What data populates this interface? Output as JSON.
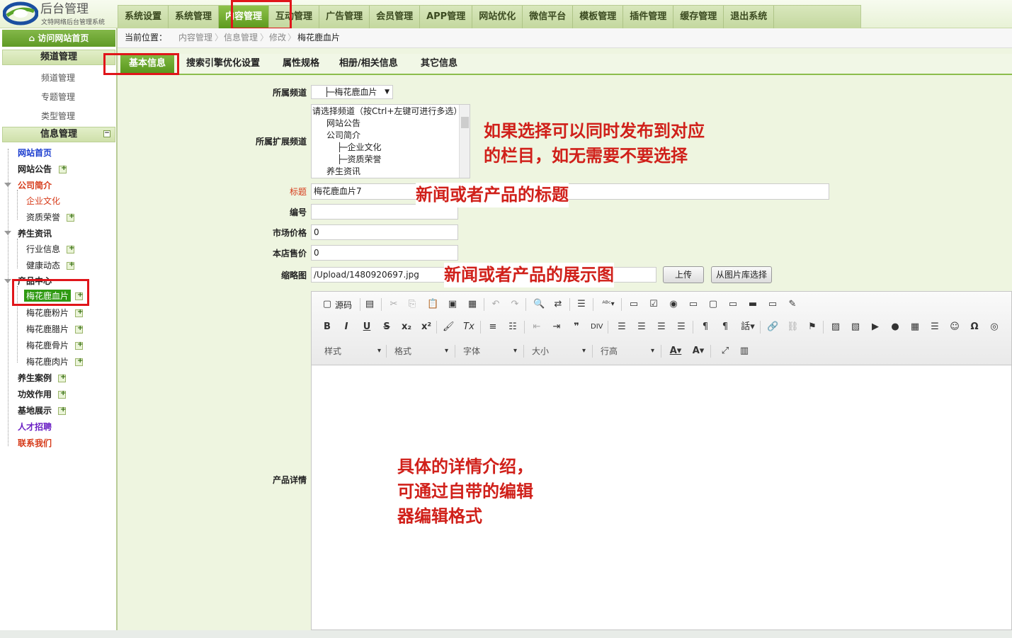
{
  "header": {
    "logo_title": "后台管理",
    "logo_sub": "文特网络后台管理系统",
    "nav": [
      "系统设置",
      "系统管理",
      "内容管理",
      "互动管理",
      "广告管理",
      "会员管理",
      "APP管理",
      "网站优化",
      "微信平台",
      "模板管理",
      "插件管理",
      "缓存管理",
      "退出系统"
    ],
    "active_nav": "内容管理"
  },
  "sidebar": {
    "visit_home": "访问网站首页",
    "channel_head": "频道管理",
    "channel_items": [
      "频道管理",
      "专题管理",
      "类型管理"
    ],
    "info_head": "信息管理",
    "tree": [
      {
        "label": "网站首页",
        "color": "#1a3ccf"
      },
      {
        "label": "网站公告",
        "color": "#222"
      },
      {
        "label": "公司简介",
        "color": "#d63b1a"
      },
      {
        "label": "企业文化",
        "color": "#d63b1a"
      },
      {
        "label": "资质荣誉",
        "color": "#222"
      },
      {
        "label": "养生资讯",
        "color": "#222"
      },
      {
        "label": "行业信息",
        "color": "#222"
      },
      {
        "label": "健康动态",
        "color": "#222"
      },
      {
        "label": "产品中心",
        "color": "#222"
      },
      {
        "label": "梅花鹿血片",
        "color": "#fff"
      },
      {
        "label": "梅花鹿粉片",
        "color": "#222"
      },
      {
        "label": "梅花鹿腊片",
        "color": "#222"
      },
      {
        "label": "梅花鹿骨片",
        "color": "#222"
      },
      {
        "label": "梅花鹿肉片",
        "color": "#222"
      },
      {
        "label": "养生案例",
        "color": "#222"
      },
      {
        "label": "功效作用",
        "color": "#222"
      },
      {
        "label": "基地展示",
        "color": "#222"
      },
      {
        "label": "人才招聘",
        "color": "#6a1fc4"
      },
      {
        "label": "联系我们",
        "color": "#d63b1a"
      }
    ]
  },
  "breadcrumb": {
    "prefix": "当前位置：",
    "items": [
      "内容管理",
      "信息管理",
      "修改",
      "梅花鹿血片"
    ]
  },
  "tabs": [
    "基本信息",
    "搜索引擎优化设置",
    "属性规格",
    "相册/相关信息",
    "其它信息"
  ],
  "form": {
    "channel_label": "所属频道",
    "channel_value": "├─梅花鹿血片",
    "ext_channel_label": "所属扩展频道",
    "ext_channel_options": [
      "请选择频道（按Ctrl+左键可进行多选）",
      "网站公告",
      "公司简介",
      "├─企业文化",
      "├─资质荣誉",
      "养生资讯"
    ],
    "title_label": "标题",
    "title_value": "梅花鹿血片7",
    "code_label": "编号",
    "code_value": "",
    "market_price_label": "市场价格",
    "market_price_value": "0",
    "shop_price_label": "本店售价",
    "shop_price_value": "0",
    "thumb_label": "缩略图",
    "thumb_value": "/Upload/1480920697.jpg",
    "upload_button": "上传",
    "library_button": "从图片库选择",
    "detail_label": "产品详情"
  },
  "editor": {
    "source_label": "源码",
    "combos": [
      "样式",
      "格式",
      "字体",
      "大小",
      "行高"
    ]
  },
  "annotations": {
    "ext_channel": [
      "如果选择可以同时发布到对应",
      "的栏目，如无需要不要选择"
    ],
    "title": "新闻或者产品的标题",
    "thumb": "新闻或者产品的展示图",
    "detail": [
      "具体的详情介绍，",
      "可通过自带的编辑",
      "器编辑格式"
    ]
  }
}
